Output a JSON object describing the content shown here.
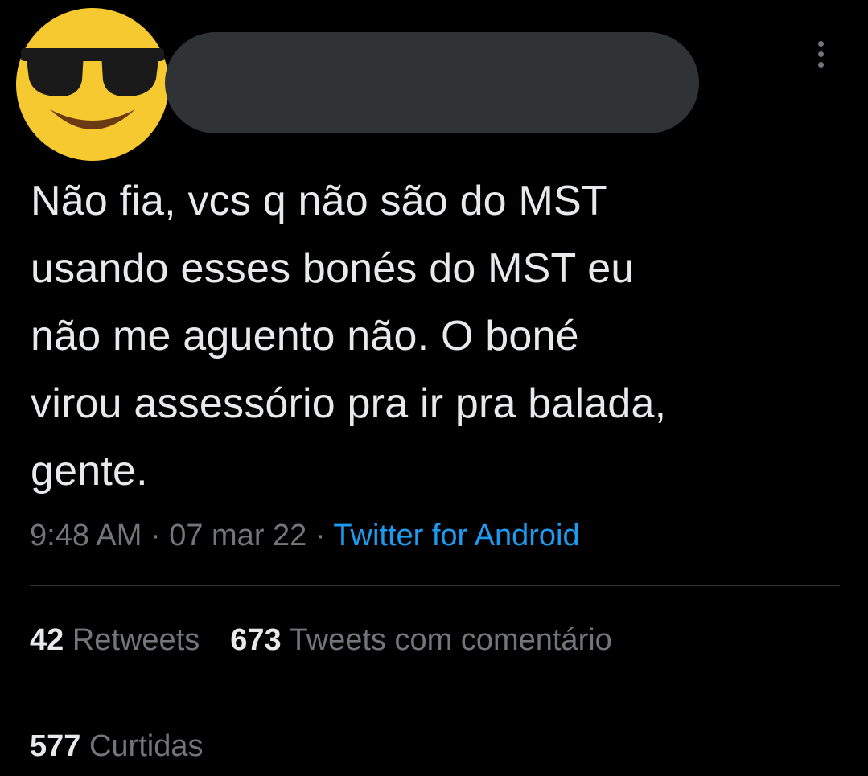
{
  "tweet": {
    "avatar_icon": "sunglasses-emoji-icon",
    "more_icon": "more-vertical-icon",
    "text": "Não fia, vcs q não são do MST\nusando esses bonés do MST eu\nnão me aguento não. O boné\nvirou assessório pra ir pra balada,\ngente.",
    "time": "9:48 AM",
    "date": "07 mar 22",
    "separator": " · ",
    "source": "Twitter for Android"
  },
  "stats": {
    "retweets_count": "42",
    "retweets_label": "Retweets",
    "quotes_count": "673",
    "quotes_label": "Tweets com comentário",
    "likes_count": "577",
    "likes_label": "Curtidas"
  },
  "colors": {
    "background": "#000000",
    "text": "#e7e9ea",
    "muted": "#71767b",
    "link": "#1d9bf0",
    "divider": "#2f3336",
    "avatar_yellow": "#f5c518",
    "redaction": "#2f3336"
  }
}
